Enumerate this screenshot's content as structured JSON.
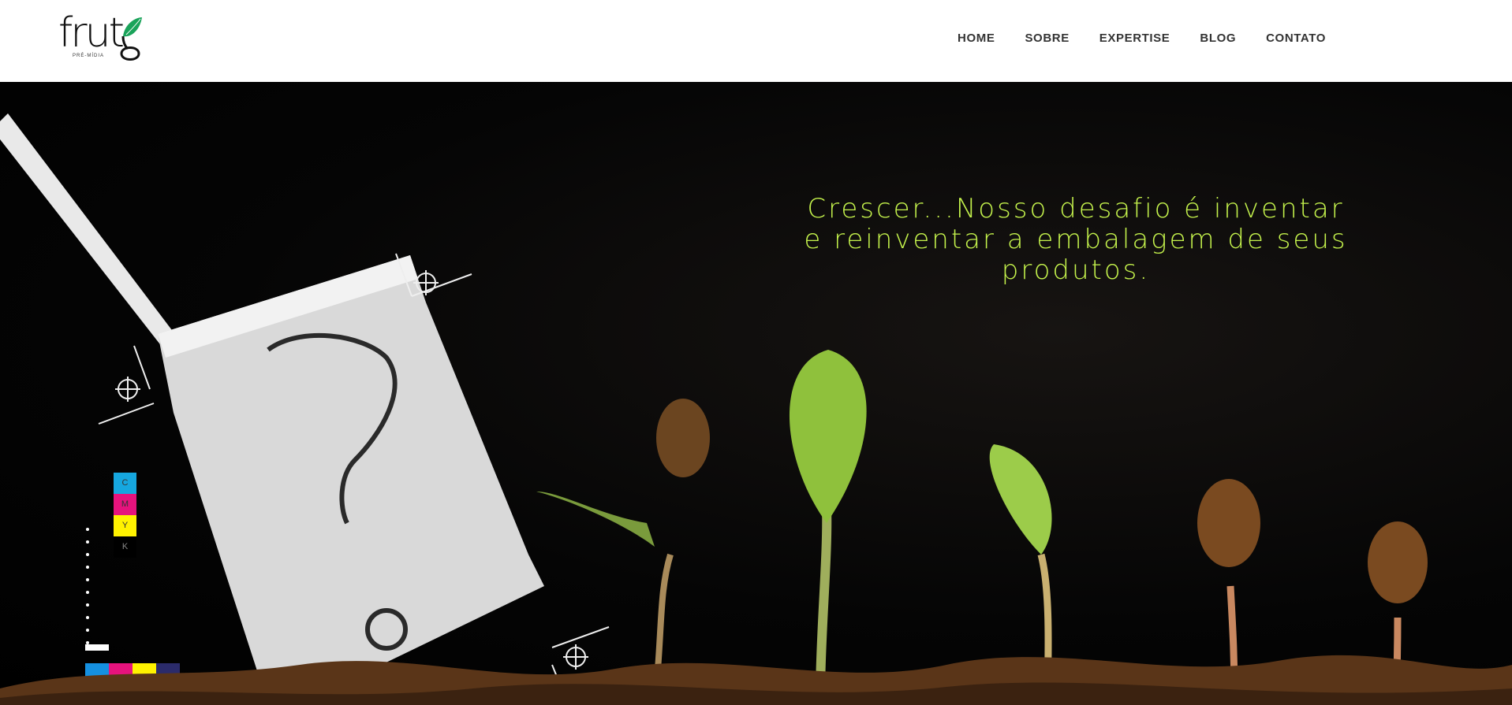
{
  "brand": {
    "logo_text": "frut",
    "logo_subtitle": "PRÉ-MÍDIA",
    "accent_green": "#1aa35a"
  },
  "nav": {
    "items": [
      {
        "label": "HOME"
      },
      {
        "label": "SOBRE"
      },
      {
        "label": "EXPERTISE"
      },
      {
        "label": "BLOG"
      },
      {
        "label": "CONTATO"
      }
    ]
  },
  "hero": {
    "headline": "Crescer...Nosso desafio é inventar e reinventar a embalagem de seus produtos.",
    "headline_color": "#c4f24c",
    "cmyk_labels": [
      "C",
      "M",
      "Y",
      "K"
    ],
    "cmyk_colors": [
      "#16a7df",
      "#e6137d",
      "#fff200",
      "#000000"
    ]
  }
}
